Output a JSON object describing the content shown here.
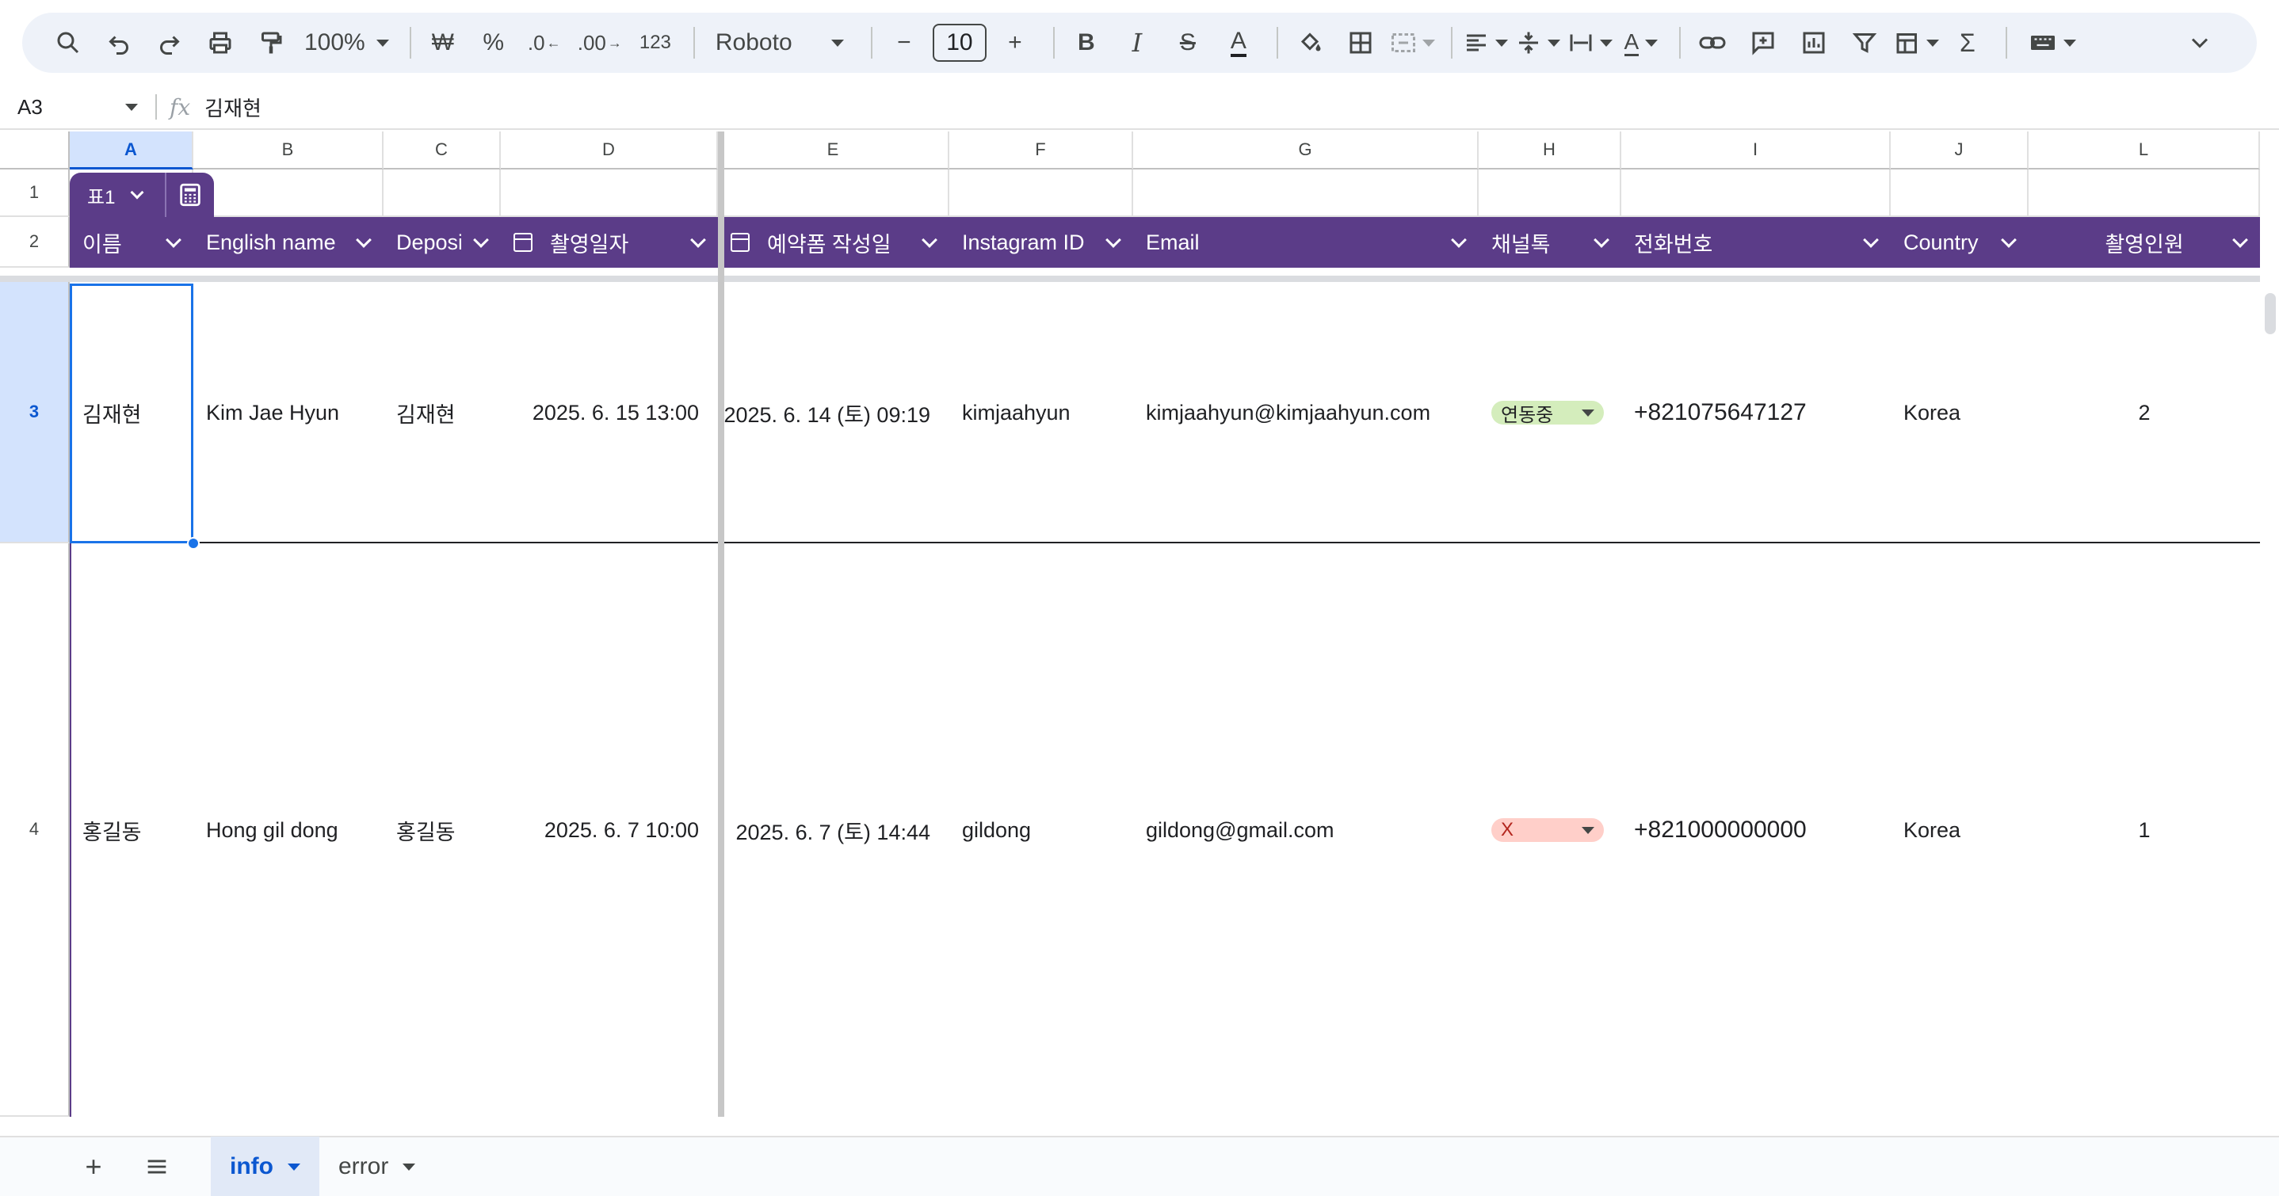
{
  "toolbar": {
    "zoom": "100%",
    "currency": "₩",
    "percent": "%",
    "decrease_decimal": ".0",
    "increase_decimal": ".00",
    "number_format": "123",
    "font": "Roboto",
    "font_size": "10",
    "minus": "−",
    "plus": "+"
  },
  "formula_bar": {
    "cell_ref": "A3",
    "fx": "fx",
    "value": "김재현"
  },
  "columns": [
    "A",
    "B",
    "C",
    "D",
    "E",
    "F",
    "G",
    "H",
    "I",
    "J",
    "L"
  ],
  "rows": [
    "1",
    "2",
    "3",
    "4"
  ],
  "table": {
    "name": "표1",
    "headers": [
      "이름",
      "English name",
      "Deposi",
      "촬영일자",
      "예약폼 작성일",
      "Instagram ID",
      "Email",
      "채널톡",
      "전화번호",
      "Country",
      "촬영인원"
    ],
    "records": [
      {
        "name": "김재현",
        "english_name": "Kim Jae Hyun",
        "depositor": "김재현",
        "shoot_date": "2025. 6. 15  13:00",
        "form_date": "2025. 6. 14 (토) 09:19",
        "instagram": "kimjaahyun",
        "email": "kimjaahyun@kimjaahyun.com",
        "channel": "연동중",
        "phone": "+821075647127",
        "country": "Korea",
        "people": "2"
      },
      {
        "name": "홍길동",
        "english_name": "Hong gil dong",
        "depositor": "홍길동",
        "shoot_date": "2025. 6. 7  10:00",
        "form_date": "2025. 6. 7 (토) 14:44",
        "instagram": "gildong",
        "email": "gildong@gmail.com",
        "channel": "X",
        "phone": "+821000000000",
        "country": "Korea",
        "people": "1"
      }
    ]
  },
  "sheets": [
    "info",
    "error"
  ],
  "colors": {
    "header_bg": "#5b3c88",
    "chip_green": "#d4edbc",
    "chip_red": "#ffcfc9",
    "selection": "#1a73e8"
  }
}
